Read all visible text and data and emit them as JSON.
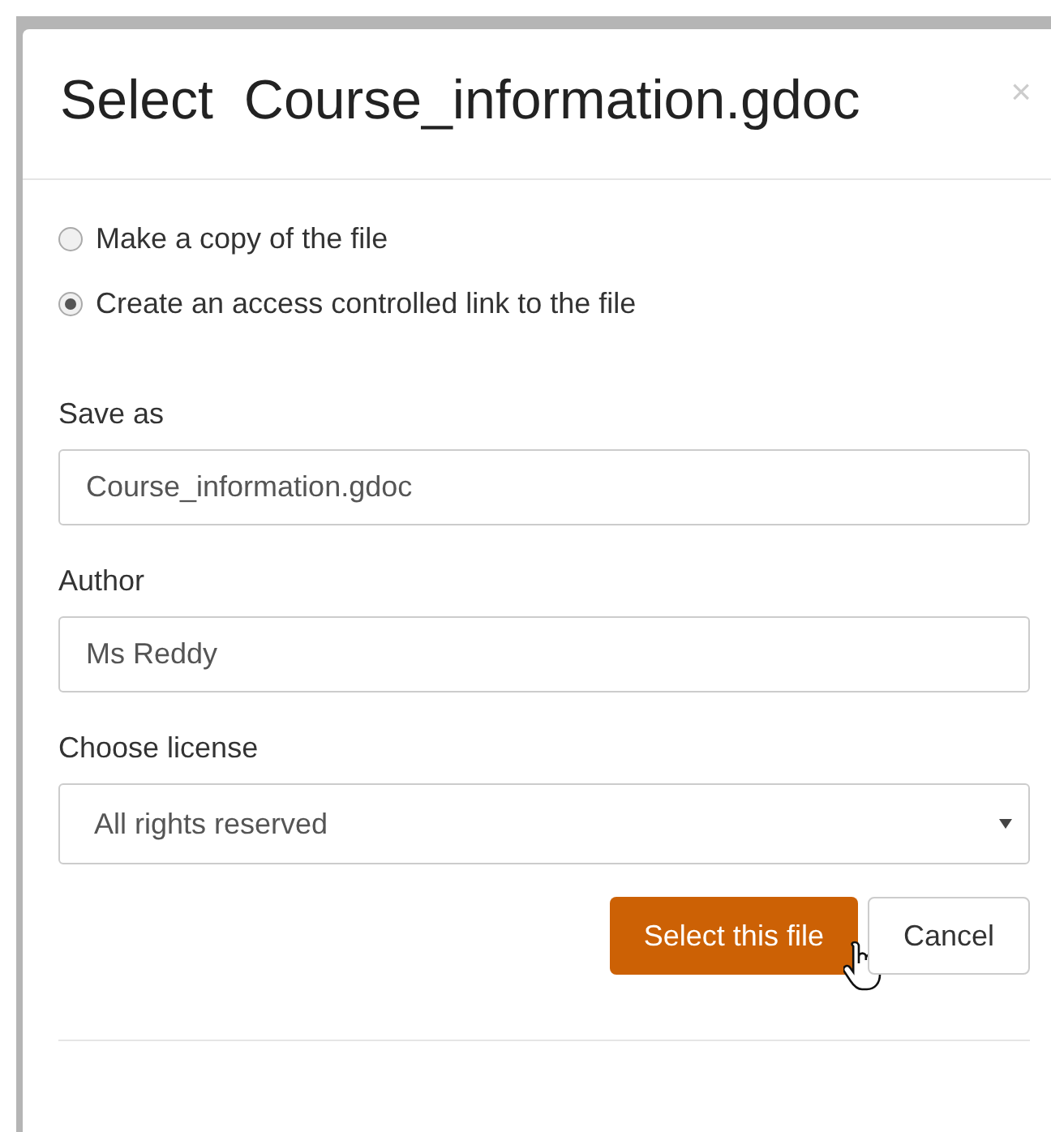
{
  "dialog": {
    "title_prefix": "Select",
    "title_file": "Course_information.gdoc",
    "close": "×"
  },
  "options": [
    {
      "label": "Make a copy of the file",
      "selected": false
    },
    {
      "label": "Create an access controlled link to the file",
      "selected": true
    }
  ],
  "fields": [
    {
      "kind": "text",
      "label": "Save as",
      "value": "Course_information.gdoc"
    },
    {
      "kind": "text",
      "label": "Author",
      "value": "Ms Reddy"
    },
    {
      "kind": "select",
      "label": "Choose license",
      "value": "All rights reserved"
    }
  ],
  "buttons": [
    {
      "label": "Select this file",
      "kind": "primary"
    },
    {
      "label": "Cancel",
      "kind": "default"
    }
  ]
}
